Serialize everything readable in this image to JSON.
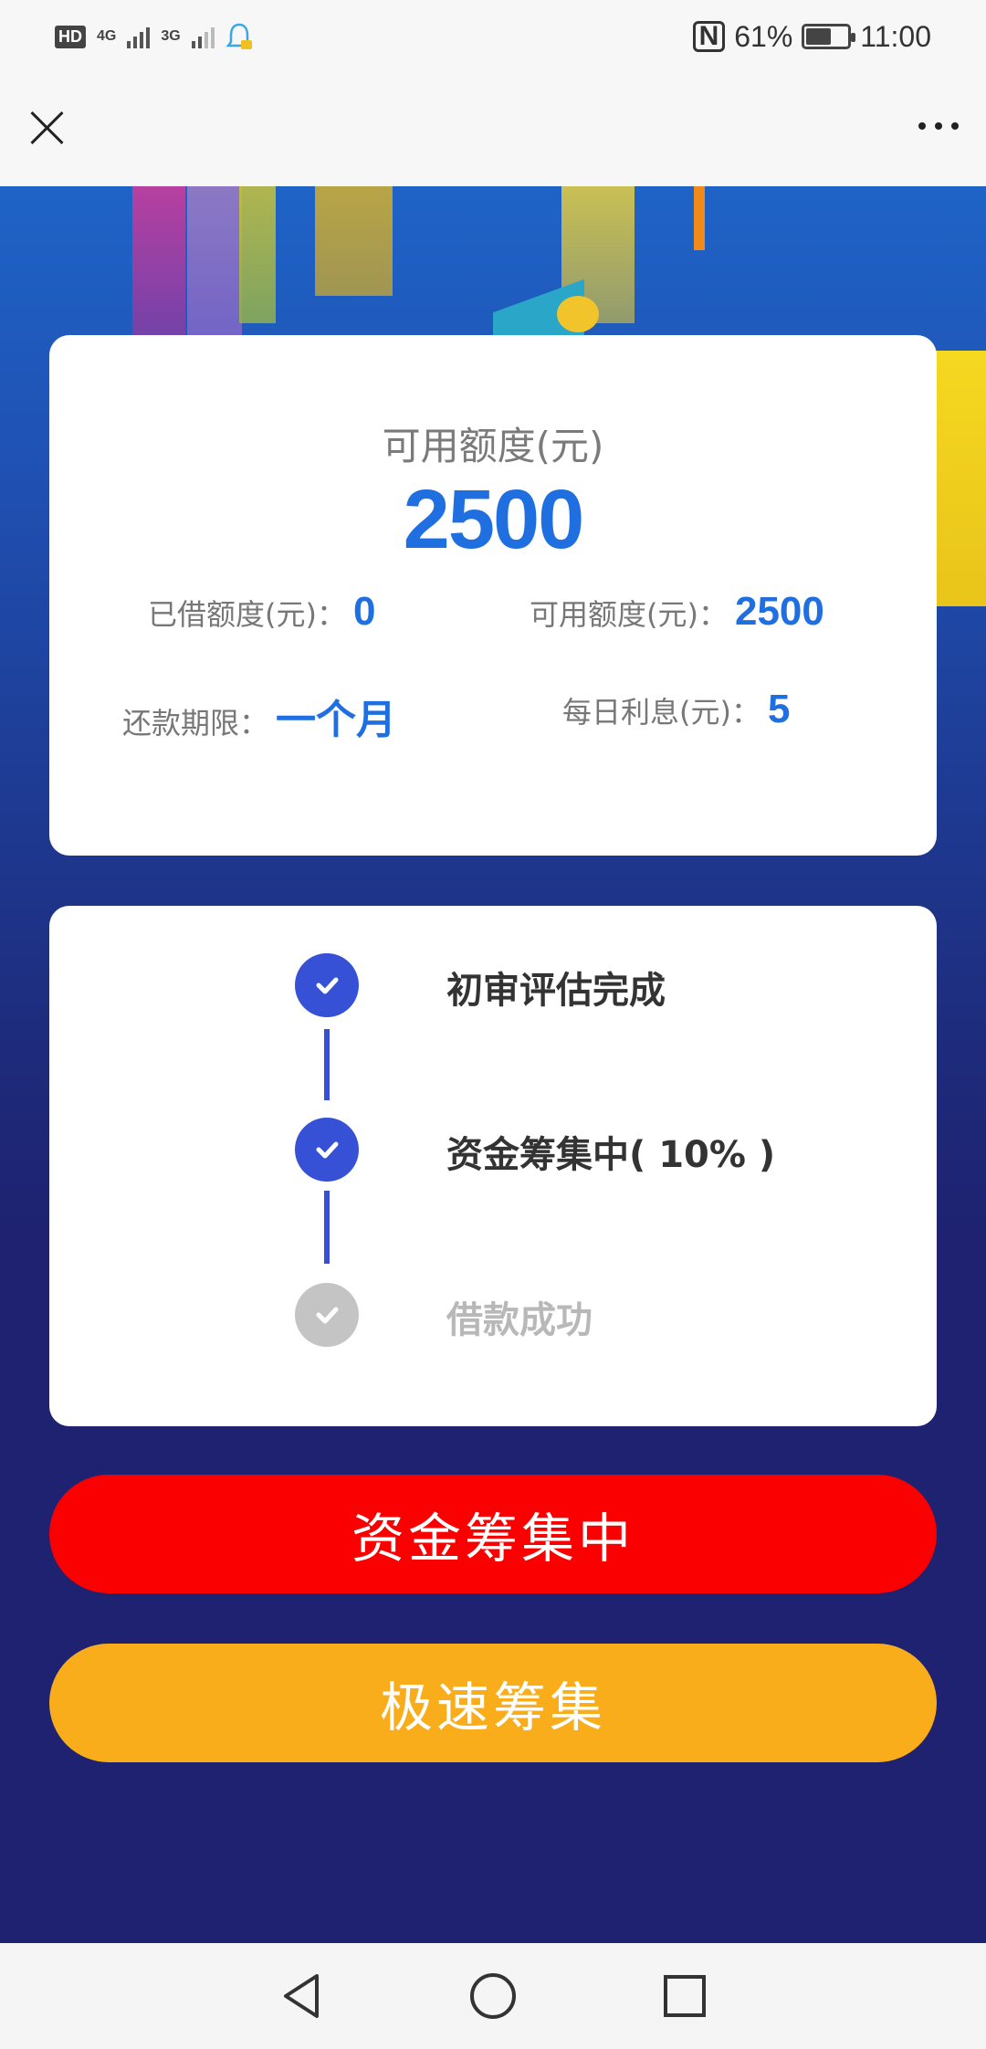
{
  "status_bar": {
    "hd": "HD",
    "net1": "4G",
    "net2": "3G",
    "nfc": "N",
    "battery": "61%",
    "time": "11:00"
  },
  "top_bar": {
    "close_icon": "close-icon",
    "more_icon": "more-icon"
  },
  "quota_card": {
    "available_label": "可用额度(元)",
    "available_value": "2500",
    "borrowed_label": "已借额度(元)：",
    "borrowed_value": "0",
    "available2_label": "可用额度(元)：",
    "available2_value": "2500",
    "term_label": "还款期限：",
    "term_value": "一个月",
    "daily_interest_label": "每日利息(元)：",
    "daily_interest_value": "5"
  },
  "progress": {
    "steps": [
      {
        "label": "初审评估完成",
        "state": "done"
      },
      {
        "label": "资金筹集中( 10% )",
        "state": "done"
      },
      {
        "label": "借款成功",
        "state": "pending"
      }
    ]
  },
  "buttons": {
    "primary": "资金筹集中",
    "secondary": "极速筹集"
  },
  "colors": {
    "accent_blue": "#1f6fe0",
    "step_blue": "#3650d6",
    "primary_red": "#fb0000",
    "secondary_orange": "#f9ad1b",
    "background_navy": "#1e2270"
  }
}
